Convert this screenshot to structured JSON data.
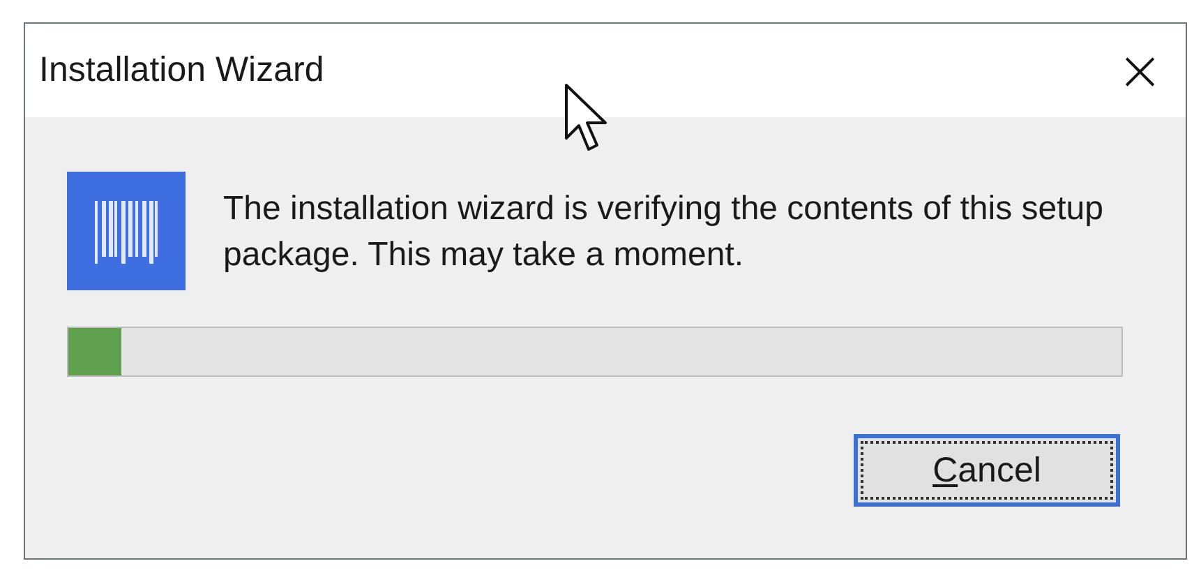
{
  "window": {
    "title": "Installation Wizard",
    "close": "×"
  },
  "message": "The installation wizard is verifying the contents of this setup package. This may take a moment.",
  "progress": {
    "level": 0.05
  },
  "buttons": [
    {
      "label": "Cancel",
      "focused": true
    }
  ]
}
